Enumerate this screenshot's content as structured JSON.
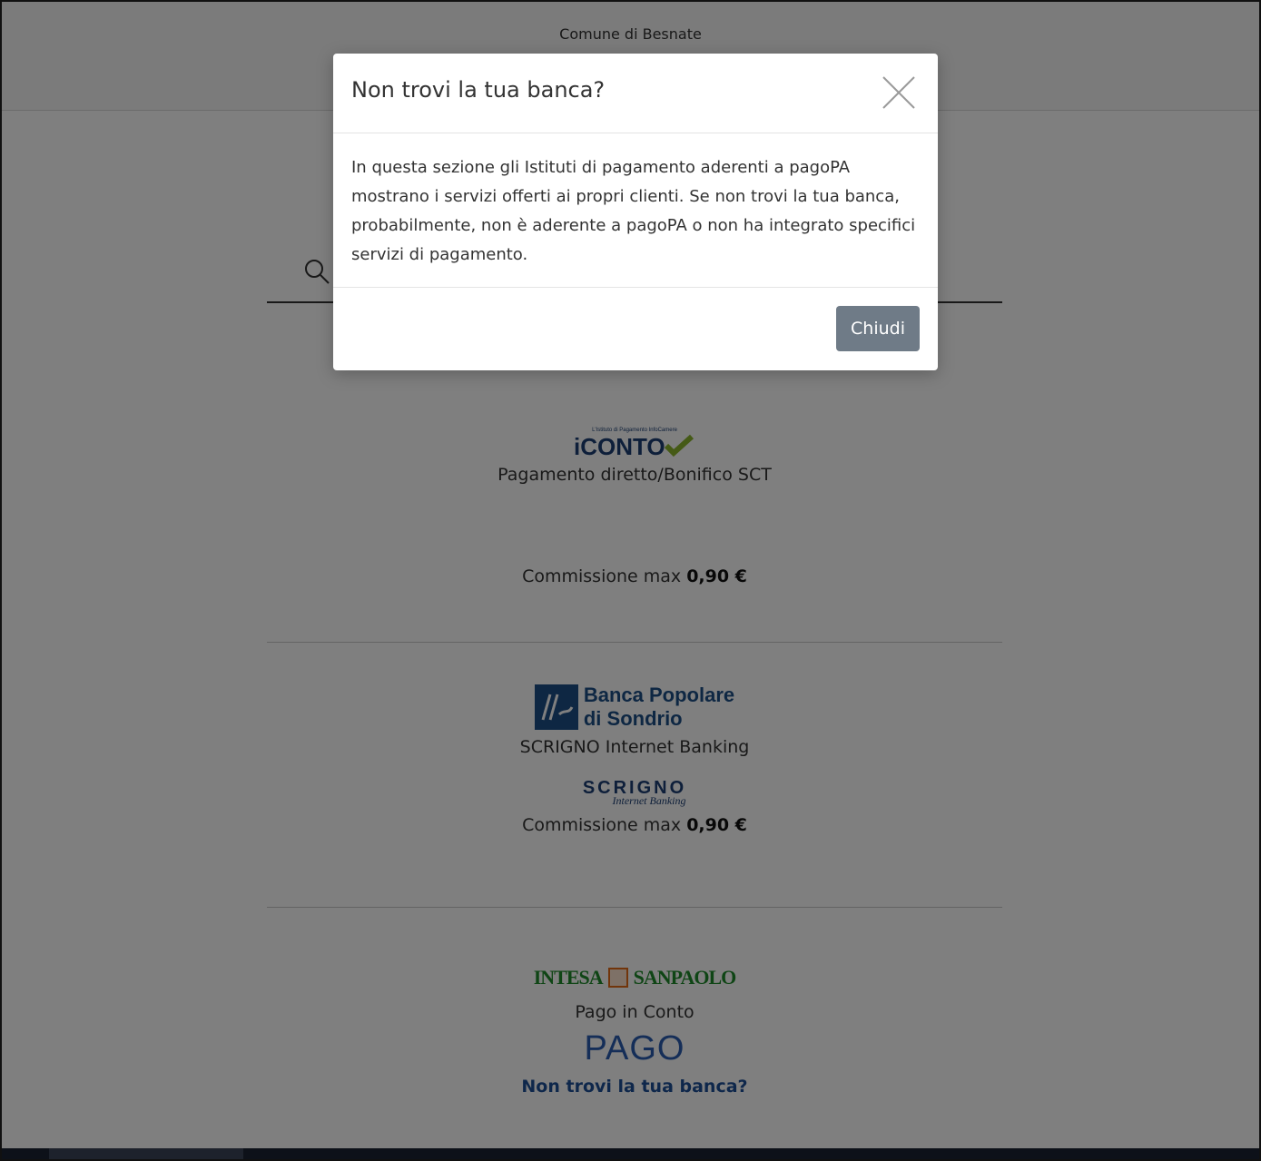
{
  "header": {
    "comune": "Comune di Besnate"
  },
  "modal": {
    "title": "Non trovi la tua banca?",
    "body": "In questa sezione gli Istituti di pagamento aderenti a pagoPA mostrano i servizi offerti ai propri clienti. Se non trovi la tua banca, probabilmente, non è aderente a pagoPA o non ha integrato specifici servizi di pagamento.",
    "close_label": "Chiudi"
  },
  "providers": [
    {
      "logo_text": "iCONTO",
      "logo_subtitle": "L'Istituto di Pagamento InfoCamere",
      "service": "Pagamento diretto/Bonifico SCT",
      "commission_label": "Commissione max",
      "commission_value": "0,90 €"
    },
    {
      "logo_text_line1": "Banca Popolare",
      "logo_text_line2": "di Sondrio",
      "service": "SCRIGNO Internet Banking",
      "sublogo_main": "SCRIGNO",
      "sublogo_sub": "Internet Banking",
      "commission_label": "Commissione max",
      "commission_value": "0,90 €"
    },
    {
      "logo_left": "INTESA",
      "logo_right": "SANPAOLO",
      "service": "Pago in Conto",
      "sublogo": "PAGO"
    }
  ],
  "footer_link": "Non trovi la tua banca?",
  "colors": {
    "overlay": "#000000",
    "button": "#6f7b87",
    "link": "#1d4e96"
  }
}
